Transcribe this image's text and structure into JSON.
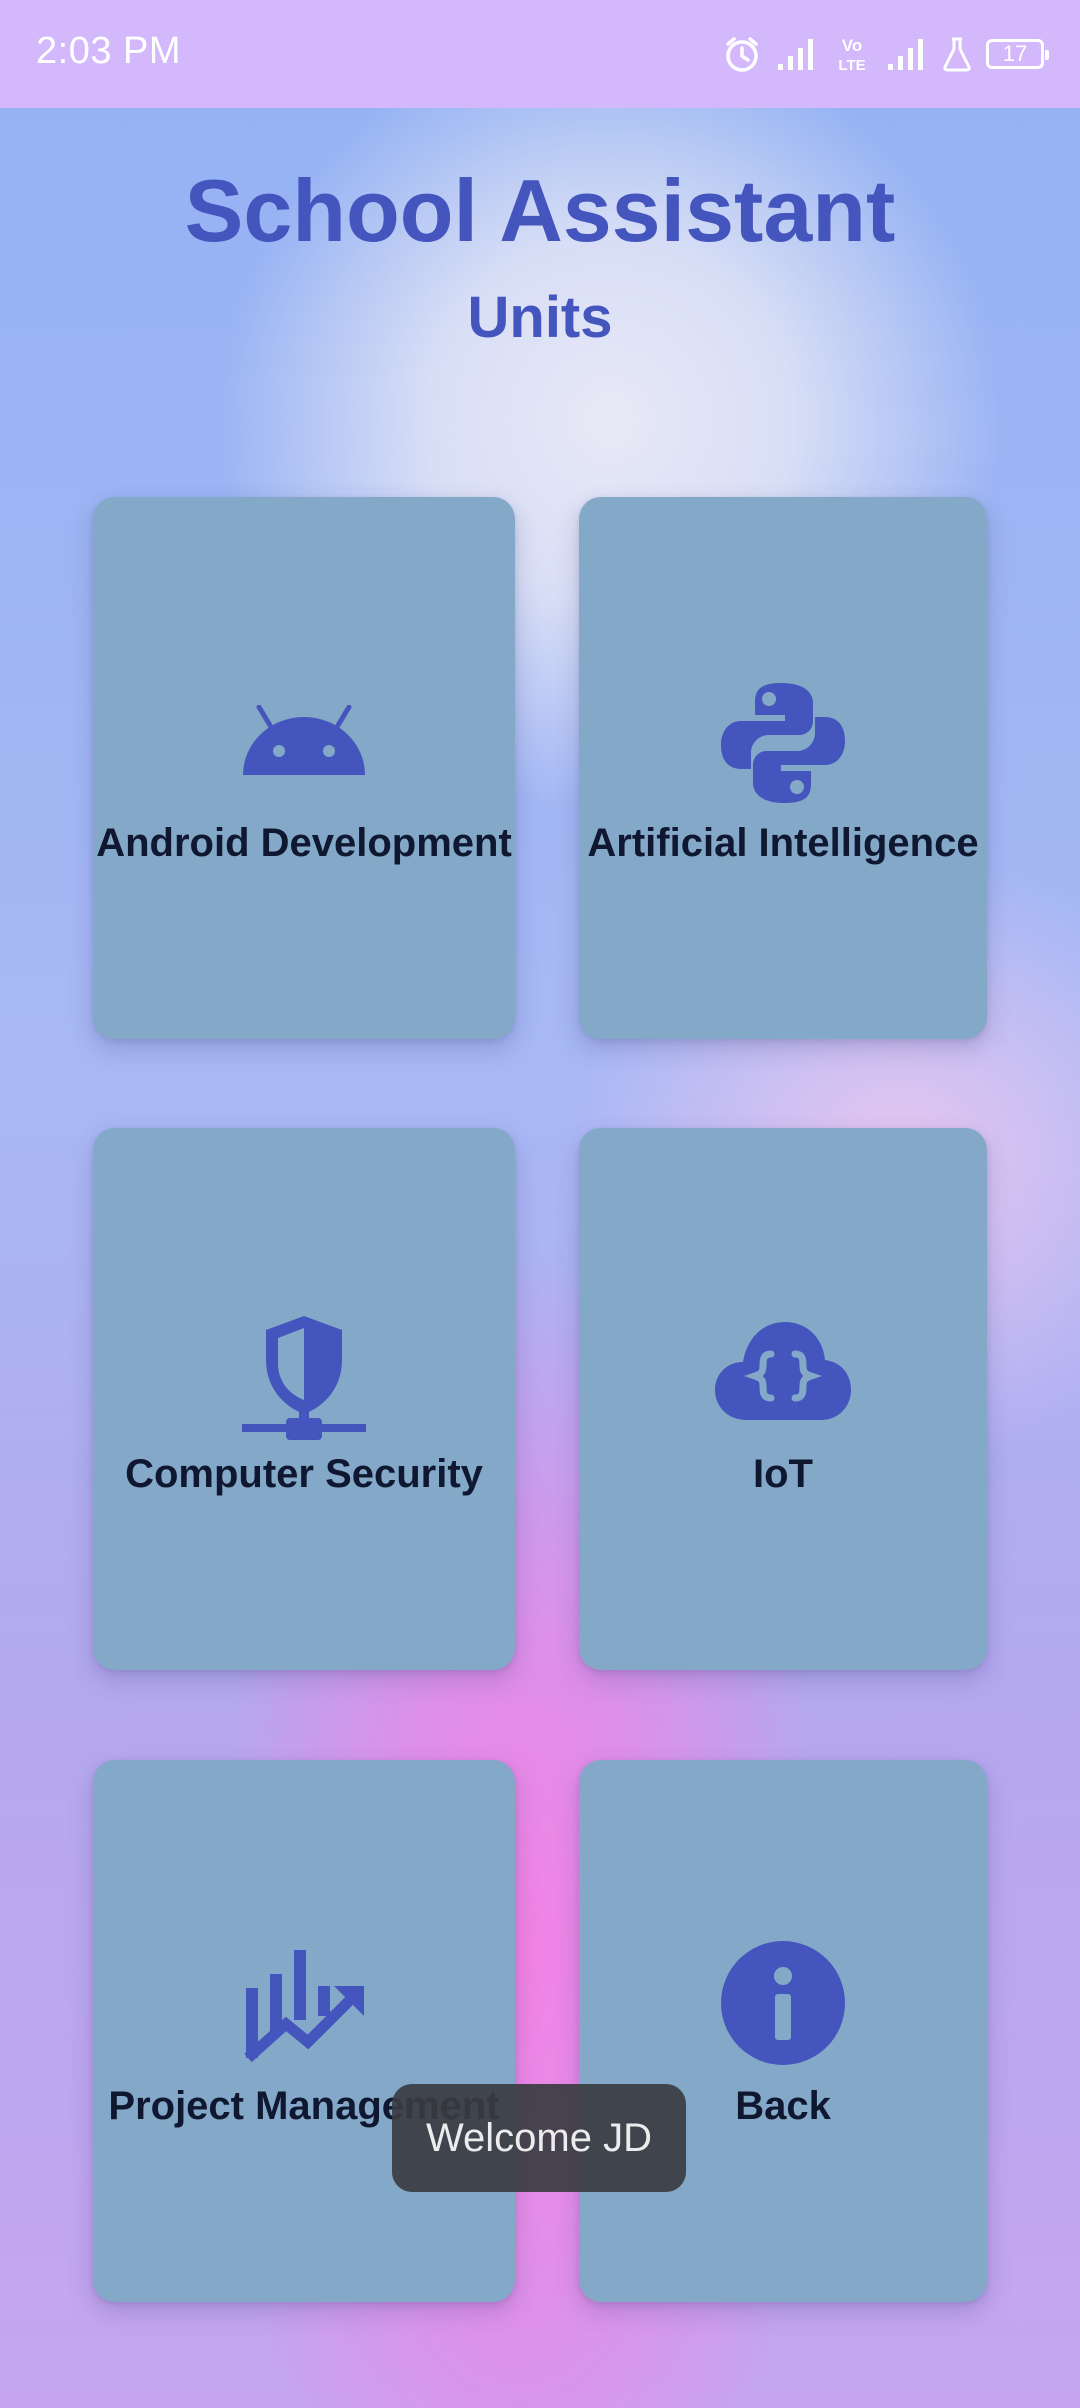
{
  "status_bar": {
    "time": "2:03 PM",
    "battery": "17",
    "icons": [
      "alarm-icon",
      "signal-icon",
      "volte-icon",
      "signal-icon",
      "flask-icon",
      "battery-icon"
    ]
  },
  "header": {
    "title": "School Assistant",
    "subtitle": "Units"
  },
  "units": [
    {
      "label": "Android Development",
      "icon": "android-icon"
    },
    {
      "label": "Artificial Intelligence",
      "icon": "python-icon"
    },
    {
      "label": "Computer Security",
      "icon": "security-shield-icon"
    },
    {
      "label": "IoT",
      "icon": "cloud-code-icon"
    },
    {
      "label": "Project Management",
      "icon": "analytics-chart-icon"
    },
    {
      "label": "Back",
      "icon": "info-icon"
    }
  ],
  "toast": {
    "text": "Welcome JD"
  },
  "colors": {
    "status_bar": "#d3b8fc",
    "title": "#4455bd",
    "card": "#84a9c8",
    "icon": "#4455bd",
    "card_text": "#0f1830"
  }
}
